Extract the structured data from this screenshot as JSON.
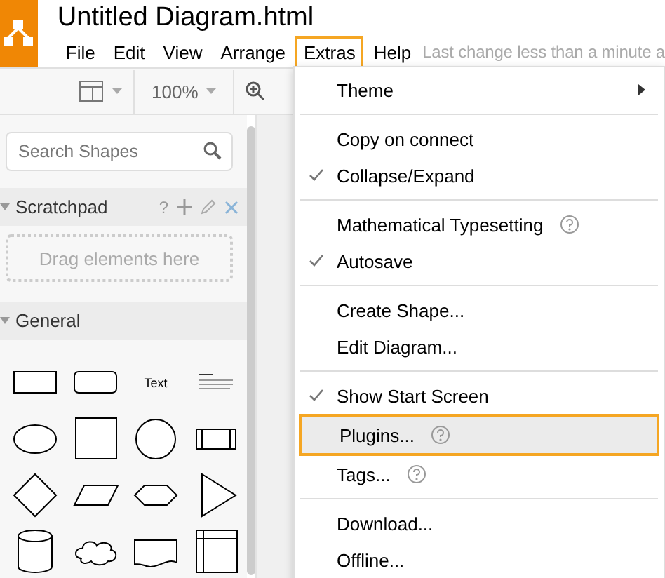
{
  "app": {
    "title": "Untitled Diagram.html",
    "status": "Last change less than a minute a"
  },
  "menubar": [
    {
      "label": "File",
      "selected": false
    },
    {
      "label": "Edit",
      "selected": false
    },
    {
      "label": "View",
      "selected": false
    },
    {
      "label": "Arrange",
      "selected": false
    },
    {
      "label": "Extras",
      "selected": true
    },
    {
      "label": "Help",
      "selected": false
    }
  ],
  "toolbar": {
    "zoom": "100%"
  },
  "sidebar": {
    "search": {
      "placeholder": "Search Shapes"
    },
    "scratchpad": {
      "title": "Scratchpad",
      "expanded": true,
      "help": "?",
      "drop_hint": "Drag elements here"
    },
    "general": {
      "title": "General",
      "expanded": true,
      "shapes": [
        {
          "kind": "rect"
        },
        {
          "kind": "rounded"
        },
        {
          "kind": "text",
          "label": "Text"
        },
        {
          "kind": "heading"
        },
        {
          "kind": "ellipse"
        },
        {
          "kind": "square"
        },
        {
          "kind": "circle"
        },
        {
          "kind": "process"
        },
        {
          "kind": "diamond"
        },
        {
          "kind": "parallelogram"
        },
        {
          "kind": "hexagon"
        },
        {
          "kind": "triangle"
        },
        {
          "kind": "cylinder"
        },
        {
          "kind": "cloud"
        },
        {
          "kind": "document"
        },
        {
          "kind": "internal"
        }
      ]
    }
  },
  "extras_menu": [
    [
      {
        "label": "Theme",
        "checked": false,
        "help": false,
        "submenu": true,
        "selected": false
      }
    ],
    [
      {
        "label": "Copy on connect",
        "checked": false,
        "help": false,
        "submenu": false,
        "selected": false
      },
      {
        "label": "Collapse/Expand",
        "checked": true,
        "help": false,
        "submenu": false,
        "selected": false
      }
    ],
    [
      {
        "label": "Mathematical Typesetting",
        "checked": false,
        "help": true,
        "submenu": false,
        "selected": false
      },
      {
        "label": "Autosave",
        "checked": true,
        "help": false,
        "submenu": false,
        "selected": false
      }
    ],
    [
      {
        "label": "Create Shape...",
        "checked": false,
        "help": false,
        "submenu": false,
        "selected": false
      },
      {
        "label": "Edit Diagram...",
        "checked": false,
        "help": false,
        "submenu": false,
        "selected": false
      }
    ],
    [
      {
        "label": "Show Start Screen",
        "checked": true,
        "help": false,
        "submenu": false,
        "selected": false
      },
      {
        "label": "Plugins...",
        "checked": false,
        "help": true,
        "submenu": false,
        "selected": true
      },
      {
        "label": "Tags...",
        "checked": false,
        "help": true,
        "submenu": false,
        "selected": false
      }
    ],
    [
      {
        "label": "Download...",
        "checked": false,
        "help": false,
        "submenu": false,
        "selected": false
      },
      {
        "label": "Offline...",
        "checked": false,
        "help": false,
        "submenu": false,
        "selected": false
      }
    ]
  ]
}
